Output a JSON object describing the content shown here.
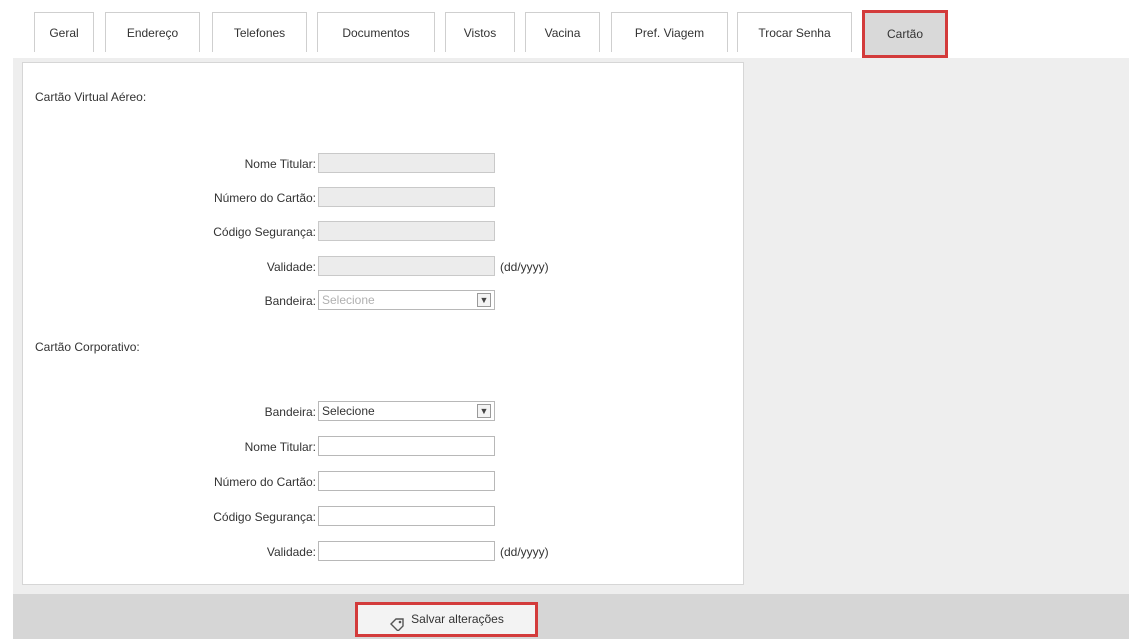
{
  "tabs": [
    {
      "label": "Geral"
    },
    {
      "label": "Endereço"
    },
    {
      "label": "Telefones"
    },
    {
      "label": "Documentos"
    },
    {
      "label": "Vistos"
    },
    {
      "label": "Vacina"
    },
    {
      "label": "Pref. Viagem"
    },
    {
      "label": "Trocar Senha"
    },
    {
      "label": "Cartão",
      "active": true
    }
  ],
  "virtual_card": {
    "title": "Cartão Virtual Aéreo:",
    "holder_label": "Nome Titular:",
    "number_label": "Número do Cartão:",
    "security_label": "Código Segurança:",
    "validity_label": "Validade:",
    "validity_hint": "(dd/yyyy)",
    "brand_label": "Bandeira:",
    "brand_value": "Selecione"
  },
  "corporate_card": {
    "title": "Cartão Corporativo:",
    "brand_label": "Bandeira:",
    "brand_value": "Selecione",
    "holder_label": "Nome Titular:",
    "number_label": "Número do Cartão:",
    "security_label": "Código Segurança:",
    "validity_label": "Validade:",
    "validity_hint": "(dd/yyyy)"
  },
  "footer": {
    "save_label": "Salvar alterações"
  },
  "colors": {
    "highlight": "#d33b3b",
    "active_tab_bg": "#d9d9d9"
  }
}
